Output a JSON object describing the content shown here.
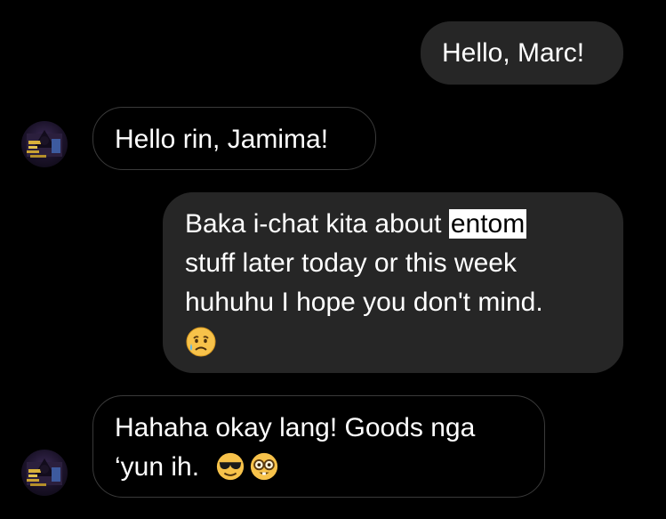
{
  "messages": [
    {
      "id": 1,
      "direction": "sent",
      "lines": [
        "Hello, Marc!"
      ]
    },
    {
      "id": 2,
      "direction": "received",
      "lines": [
        "Hello rin, Jamima!"
      ]
    },
    {
      "id": 3,
      "direction": "sent",
      "lines_before": "Baka i-chat kita about ",
      "highlighted_word": "entom",
      "lines": [
        "stuff later today or this week",
        "huhuhu I hope you don't mind."
      ],
      "emoji": "sad-relieved-face-emoji"
    },
    {
      "id": 4,
      "direction": "received",
      "lines": [
        "Hahaha okay lang! Goods nga",
        "‘yun ih. "
      ],
      "emojis": [
        "sunglasses-face-emoji",
        "nerd-face-emoji"
      ]
    }
  ],
  "colors": {
    "background": "#000000",
    "sent_bubble": "#262626",
    "received_border": "#3a3a3a",
    "text": "#ffffff",
    "highlight_bg": "#ffffff",
    "highlight_text": "#000000"
  }
}
